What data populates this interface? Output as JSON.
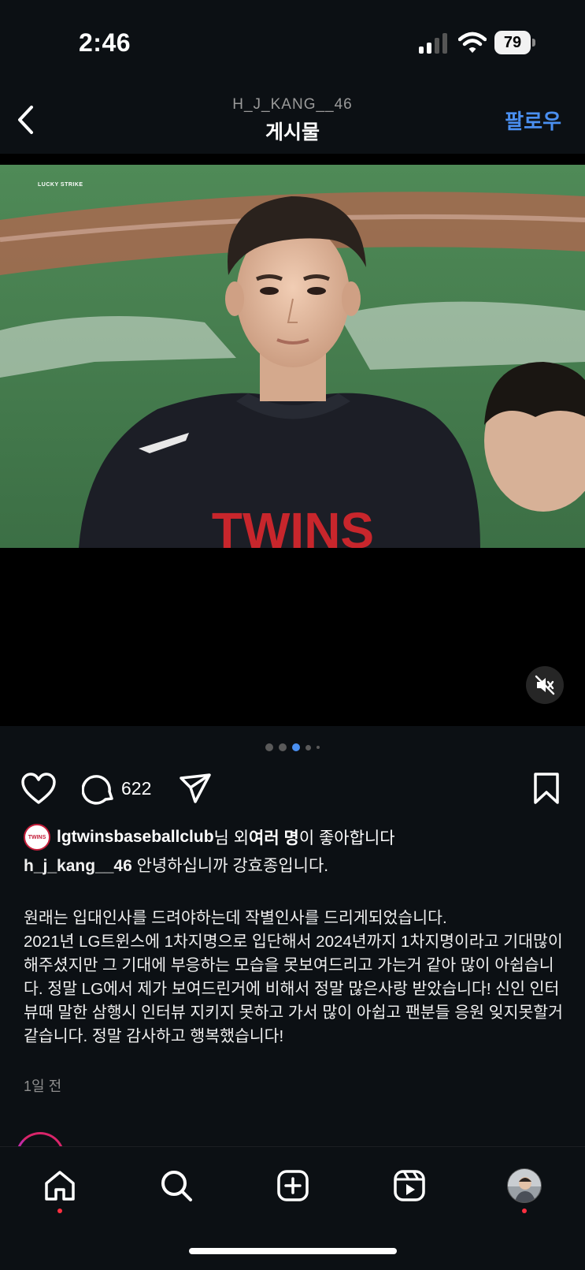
{
  "status": {
    "time": "2:46",
    "battery": "79"
  },
  "header": {
    "subtitle": "H_J_KANG__46",
    "title": "게시물",
    "follow_label": "팔로우"
  },
  "media": {
    "brand_text": "LUCKY STRIKE",
    "jersey_text": "TWINS",
    "carousel_count": 5,
    "carousel_active": 3
  },
  "actions": {
    "comment_count": "622"
  },
  "likes": {
    "user": "lgtwinsbaseballclub",
    "mid": "님 외 ",
    "many": "여러 명",
    "suffix": "이 좋아합니다",
    "badge": "TWINS"
  },
  "caption": {
    "username": "h_j_kang__46",
    "first_line": "안녕하십니까 강효종입니다.",
    "body": "원래는 입대인사를 드려야하는데 작별인사를 드리게되었습니다.\n2021년 LG트윈스에 1차지명으로 입단해서 2024년까지 1차지명이라고 기대많이 해주셨지만 그 기대에 부응하는 모습을 못보여드리고 가는거 같아 많이 아쉽습니다. 정말 LG에서 제가 보여드린거에 비해서 정말 많은사랑 받았습니다! 신인 인터뷰때 말한 삼행시 인터뷰 지키지 못하고 가서 많이 아쉽고 팬분들 응원 잊지못할거 같습니다. 정말 감사하고 행복했습니다!",
    "timestamp": "1일 전"
  },
  "colors": {
    "accent": "#4a8ff0",
    "background": "#0c1014",
    "notification": "#ff3040"
  },
  "icons": [
    "back-chevron-icon",
    "heart-icon",
    "comment-icon",
    "share-icon",
    "bookmark-icon",
    "mute-icon",
    "home-icon",
    "search-icon",
    "create-icon",
    "reels-icon"
  ]
}
